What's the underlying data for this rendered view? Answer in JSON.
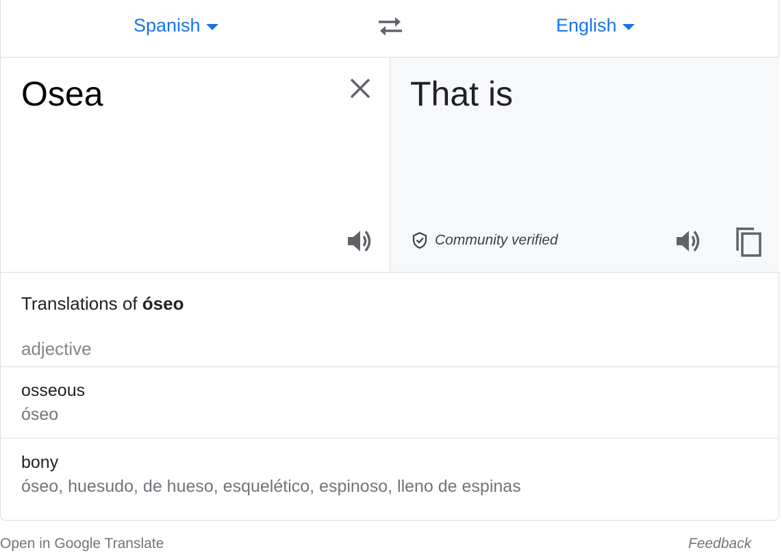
{
  "languages": {
    "source": "Spanish",
    "target": "English"
  },
  "source_text": "Osea",
  "translated_text": "That is",
  "verification": {
    "label": "Community verified"
  },
  "dictionary": {
    "title_prefix": "Translations of ",
    "title_word": "óseo",
    "part_of_speech": "adjective",
    "entries": [
      {
        "word": "osseous",
        "synonyms": "óseo"
      },
      {
        "word": "bony",
        "synonyms": "óseo, huesudo, de hueso, esquelético, espinoso, lleno de espinas"
      }
    ]
  },
  "footer": {
    "open_link": "Open in Google Translate",
    "feedback": "Feedback"
  },
  "icons": {
    "swap": "swap-arrows-icon",
    "clear": "close-icon",
    "speaker": "speaker-icon",
    "copy": "copy-icon",
    "verified": "shield-check-icon"
  },
  "colors": {
    "accent": "#1a73e8",
    "target_pane_bg": "#f7f8fa",
    "border": "#dadce0",
    "muted_text": "#70757a"
  }
}
